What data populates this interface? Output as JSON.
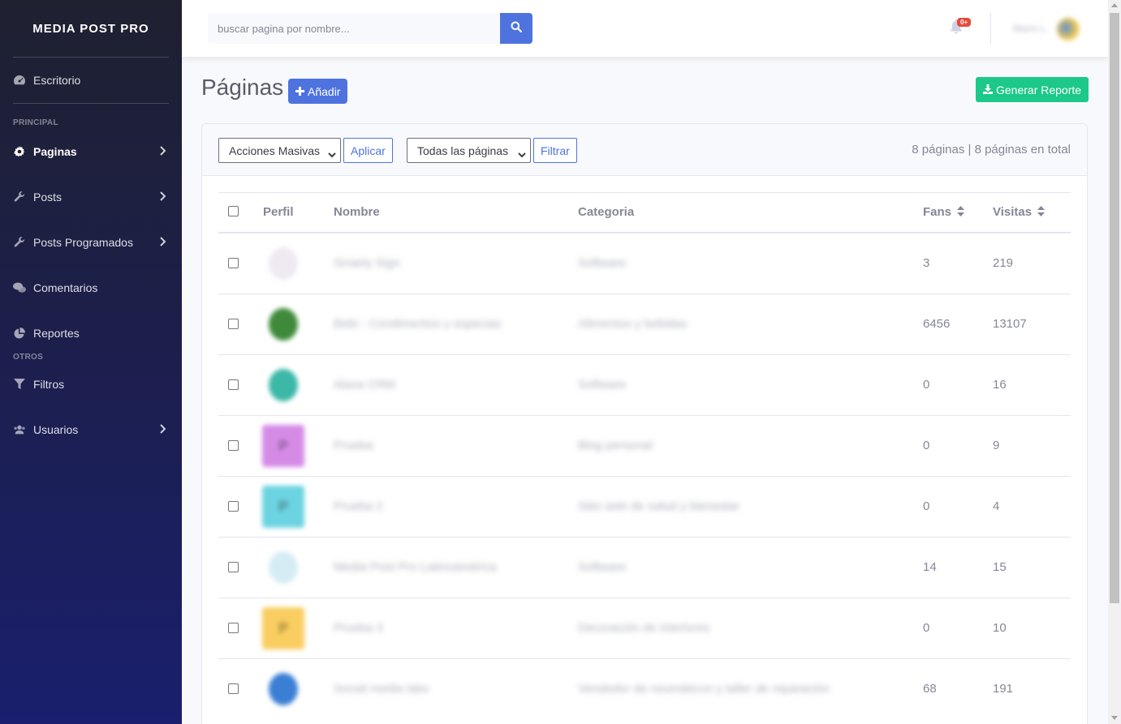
{
  "sidebar": {
    "brand": "MEDIA POST PRO",
    "dashboard": {
      "label": "Escritorio",
      "icon": "tachometer-icon"
    },
    "section_principal": "PRINCIPAL",
    "items_principal": [
      {
        "label": "Paginas",
        "icon": "gear-icon",
        "active": true
      },
      {
        "label": "Posts",
        "icon": "wrench-icon"
      },
      {
        "label": "Posts Programados",
        "icon": "wrench-icon"
      },
      {
        "label": "Comentarios",
        "icon": "comments-icon"
      },
      {
        "label": "Reportes",
        "icon": "pie-chart-icon"
      }
    ],
    "section_otros": "OTROS",
    "items_otros": [
      {
        "label": "Filtros",
        "icon": "filter-icon"
      },
      {
        "label": "Usuarios",
        "icon": "users-icon"
      }
    ]
  },
  "topbar": {
    "search_placeholder": "buscar pagina por nombre...",
    "notifications_badge": "0+",
    "user_name": "Mario L."
  },
  "header": {
    "title": "Páginas",
    "add_label": "Añadir",
    "report_label": "Generar Reporte"
  },
  "filters": {
    "bulk_select": "Acciones Masivas",
    "apply_label": "Aplicar",
    "pages_select": "Todas las páginas",
    "filter_label": "Filtrar",
    "count_text": "8 páginas | 8 páginas en total"
  },
  "table": {
    "columns": [
      "Perfil",
      "Nombre",
      "Categoria",
      "Fans",
      "Visitas"
    ],
    "rows": [
      {
        "name": "Smarty Sign",
        "category": "Software",
        "fans": "3",
        "visits": "219",
        "avatar_color": "#efe9f2",
        "avatar_letter": ""
      },
      {
        "name": "Bebi - Condimentos y especias",
        "category": "Alimentos y bebidas",
        "fans": "6456",
        "visits": "13107",
        "avatar_color": "#3f8a3a",
        "avatar_letter": ""
      },
      {
        "name": "Alaxa CRM",
        "category": "Software",
        "fans": "0",
        "visits": "16",
        "avatar_color": "#3bb8a8",
        "avatar_letter": ""
      },
      {
        "name": "Prueba",
        "category": "Blog personal",
        "fans": "0",
        "visits": "9",
        "avatar_color": "#d58be6",
        "avatar_letter": "P"
      },
      {
        "name": "Prueba 2",
        "category": "Sitio web de salud y bienestar",
        "fans": "0",
        "visits": "4",
        "avatar_color": "#6cd3e0",
        "avatar_letter": "P"
      },
      {
        "name": "Media Post Pro Latinoamérica",
        "category": "Software",
        "fans": "14",
        "visits": "15",
        "avatar_color": "#d6ecf4",
        "avatar_letter": ""
      },
      {
        "name": "Prueba 3",
        "category": "Decoración de interiores",
        "fans": "0",
        "visits": "10",
        "avatar_color": "#f9cd60",
        "avatar_letter": "P"
      },
      {
        "name": "Social media labs",
        "category": "Vendedor de neumáticos y taller de reparación",
        "fans": "68",
        "visits": "191",
        "avatar_color": "#3a7fd4",
        "avatar_letter": ""
      }
    ]
  }
}
